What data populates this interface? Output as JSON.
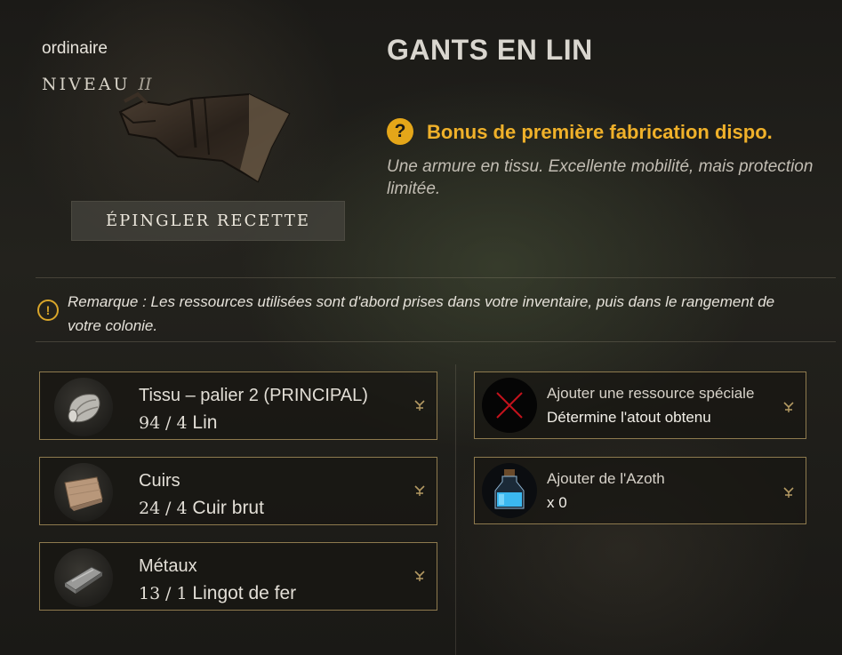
{
  "item": {
    "rarity": "ordinaire",
    "level_label": "NIVEAU",
    "level_value": "II",
    "title": "GANTS EN LIN",
    "pin_button_label": "ÉPINGLER RECETTE"
  },
  "bonus": {
    "icon": "question-icon",
    "icon_glyph": "?",
    "text": "Bonus de première fabrication dispo."
  },
  "description": "Une armure en tissu. Excellente mobilité, mais protection limitée.",
  "note": {
    "icon": "exclamation-icon",
    "icon_glyph": "!",
    "text": "Remarque : Les ressources utilisées sont d'abord prises dans votre inventaire, puis dans le rangement de votre colonie."
  },
  "resources": [
    {
      "icon": "linen-cloth-icon",
      "category": "Tissu – palier 2 (PRINCIPAL)",
      "have": "94",
      "need": "4",
      "name": "Lin"
    },
    {
      "icon": "rawhide-icon",
      "category": "Cuirs",
      "have": "24",
      "need": "4",
      "name": "Cuir brut"
    },
    {
      "icon": "iron-ingot-icon",
      "category": "Métaux",
      "have": "13",
      "need": "1",
      "name": "Lingot de fer"
    }
  ],
  "special_slots": [
    {
      "icon": "red-x-icon",
      "title": "Ajouter une ressource spéciale",
      "subtitle": "Détermine l'atout obtenu"
    },
    {
      "icon": "azoth-flask-icon",
      "title": "Ajouter de l'Azoth",
      "subtitle": "x 0"
    }
  ],
  "colors": {
    "accent_gold": "#f0b12a",
    "card_border": "#8e7a4e",
    "text": "#e2ded6"
  }
}
